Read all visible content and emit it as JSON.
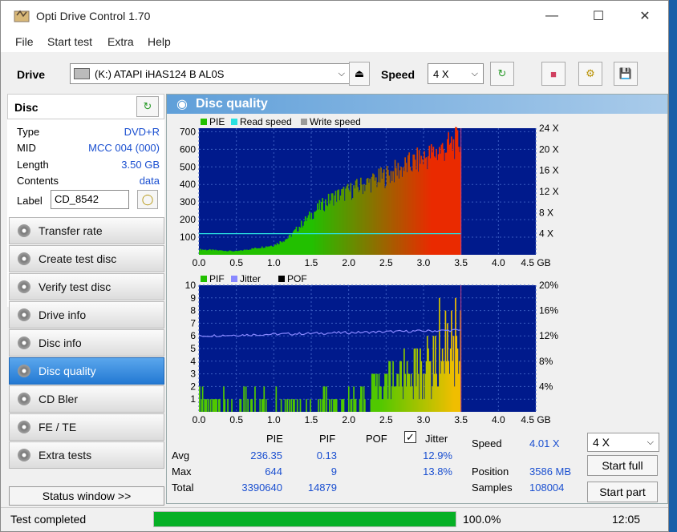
{
  "window": {
    "title": "Opti Drive Control 1.70"
  },
  "menu": [
    "File",
    "Start test",
    "Extra",
    "Help"
  ],
  "toolbar": {
    "drive_label": "Drive",
    "drive_value": "(K:)  ATAPI iHAS124   B AL0S",
    "speed_label": "Speed",
    "speed_value": "4 X"
  },
  "disc": {
    "header": "Disc",
    "rows": [
      {
        "k": "Type",
        "v": "DVD+R"
      },
      {
        "k": "MID",
        "v": "MCC 004 (000)"
      },
      {
        "k": "Length",
        "v": "3.50 GB"
      },
      {
        "k": "Contents",
        "v": "data"
      }
    ],
    "label_key": "Label",
    "label_value": "CD_8542"
  },
  "nav": [
    "Transfer rate",
    "Create test disc",
    "Verify test disc",
    "Drive info",
    "Disc info",
    "Disc quality",
    "CD Bler",
    "FE / TE",
    "Extra tests"
  ],
  "nav_active": 5,
  "status_window": "Status window >>",
  "panel": {
    "title": "Disc quality"
  },
  "chart_data": [
    {
      "type": "bar",
      "legend": [
        "PIE",
        "Read speed",
        "Write speed"
      ],
      "colors": {
        "pie": "#22c000",
        "read": "#29e0e0",
        "write": "#9a9a9a",
        "pie_hot": "#e03000"
      },
      "x_ticks": [
        "0.0",
        "0.5",
        "1.0",
        "1.5",
        "2.0",
        "2.5",
        "3.0",
        "3.5",
        "4.0",
        "4.5 GB"
      ],
      "xlim": [
        0,
        4.5
      ],
      "y_ticks": [
        100,
        200,
        300,
        400,
        500,
        600,
        700
      ],
      "ylim": [
        0,
        720
      ],
      "y2_ticks": [
        "4 X",
        "8 X",
        "12 X",
        "16 X",
        "20 X",
        "24 X"
      ],
      "y2lim": [
        0,
        24
      ],
      "pie_envelope": [
        [
          0,
          30
        ],
        [
          0.5,
          20
        ],
        [
          1.0,
          55
        ],
        [
          1.2,
          100
        ],
        [
          1.4,
          190
        ],
        [
          1.6,
          270
        ],
        [
          1.8,
          330
        ],
        [
          2.0,
          360
        ],
        [
          2.2,
          400
        ],
        [
          2.4,
          430
        ],
        [
          2.6,
          470
        ],
        [
          2.8,
          510
        ],
        [
          3.0,
          550
        ],
        [
          3.2,
          590
        ],
        [
          3.35,
          620
        ],
        [
          3.5,
          650
        ]
      ],
      "read_speed_x": 4.01,
      "end_x": 3.5
    },
    {
      "type": "bar",
      "legend": [
        "PIF",
        "Jitter",
        "POF"
      ],
      "colors": {
        "pif": "#22c000",
        "jitter": "#8888ff",
        "pof": "#000000"
      },
      "x_ticks": [
        "0.0",
        "0.5",
        "1.0",
        "1.5",
        "2.0",
        "2.5",
        "3.0",
        "3.5",
        "4.0",
        "4.5 GB"
      ],
      "xlim": [
        0,
        4.5
      ],
      "y_ticks": [
        1,
        2,
        3,
        4,
        5,
        6,
        7,
        8,
        9,
        10
      ],
      "ylim": [
        0,
        10
      ],
      "y2_ticks": [
        "4%",
        "8%",
        "12%",
        "16%",
        "20%"
      ],
      "y2lim": [
        0,
        20
      ],
      "jitter_level_pct": 12.9,
      "end_x": 3.5
    }
  ],
  "stats": {
    "cols": [
      "PIE",
      "PIF",
      "POF",
      "Jitter"
    ],
    "rows": [
      {
        "k": "Avg",
        "pie": "236.35",
        "pif": "0.13",
        "pof": "",
        "jit": "12.9%"
      },
      {
        "k": "Max",
        "pie": "644",
        "pif": "9",
        "pof": "",
        "jit": "13.8%"
      },
      {
        "k": "Total",
        "pie": "3390640",
        "pif": "14879",
        "pof": "",
        "jit": ""
      }
    ],
    "speed_k": "Speed",
    "speed_v": "4.01 X",
    "position_k": "Position",
    "position_v": "3586 MB",
    "samples_k": "Samples",
    "samples_v": "108004",
    "speed_select": "4 X"
  },
  "buttons": {
    "start_full": "Start full",
    "start_part": "Start part"
  },
  "status": {
    "text": "Test completed",
    "progress": 1.0,
    "progress_text": "100.0%",
    "time": "12:05"
  }
}
